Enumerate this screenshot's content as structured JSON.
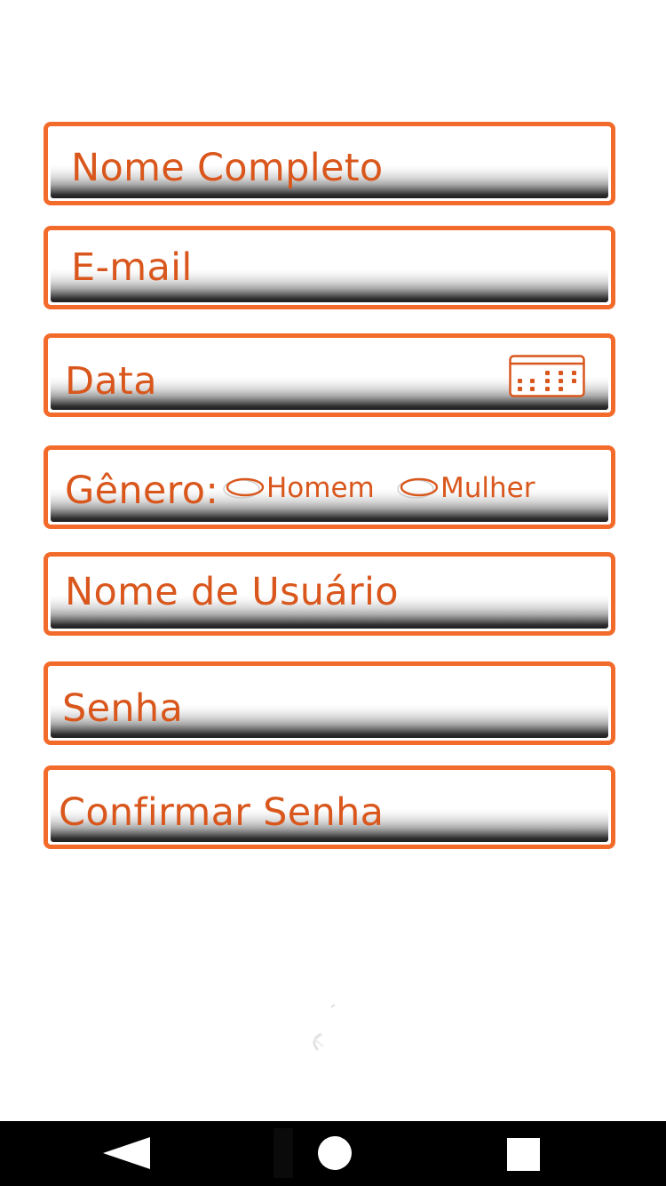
{
  "form": {
    "full_name": {
      "placeholder": "Nome Completo"
    },
    "email": {
      "placeholder": "E-mail"
    },
    "date": {
      "placeholder": "Data",
      "icon": "calendar-icon"
    },
    "gender": {
      "label": "Gênero:",
      "options": [
        {
          "label": "Homem",
          "selected": false
        },
        {
          "label": "Mulher",
          "selected": false
        }
      ]
    },
    "username": {
      "placeholder": "Nome de Usuário"
    },
    "password": {
      "placeholder": "Senha"
    },
    "confirm_password": {
      "placeholder": "Confirmar Senha"
    }
  },
  "loading": {
    "icon": "spinner-icon"
  },
  "navbar": {
    "back": {
      "icon": "back-triangle-icon"
    },
    "home": {
      "icon": "home-circle-icon"
    },
    "recents": {
      "icon": "recents-square-icon"
    }
  },
  "colors": {
    "accent": "#f26b2a",
    "label_text": "#d9571c",
    "background": "#ffffff",
    "navbar": "#000000"
  }
}
